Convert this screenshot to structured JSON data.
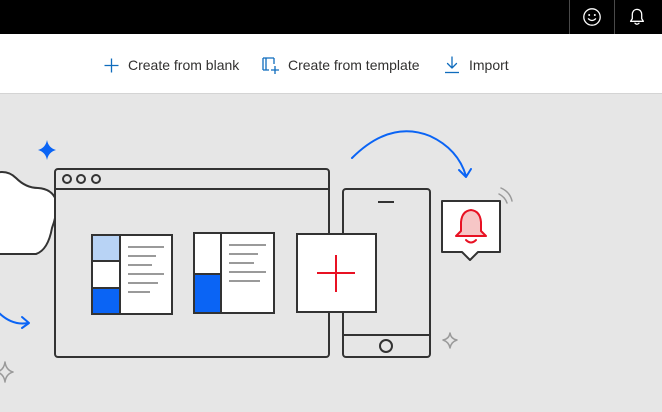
{
  "toolbar": {
    "create_blank_label": "Create from blank",
    "create_template_label": "Create from template",
    "import_label": "Import"
  },
  "colors": {
    "accent": "#0f6cbd",
    "brand_blue": "#0a64f5",
    "light_blue": "#b8d3f5",
    "alert_red": "#e81123",
    "alert_fill": "#f6c6c6",
    "canvas_bg": "#e6e6e6",
    "stroke": "#333333"
  },
  "icons": [
    "smiley-icon",
    "bell-icon",
    "plus-icon",
    "template-icon",
    "download-icon"
  ]
}
